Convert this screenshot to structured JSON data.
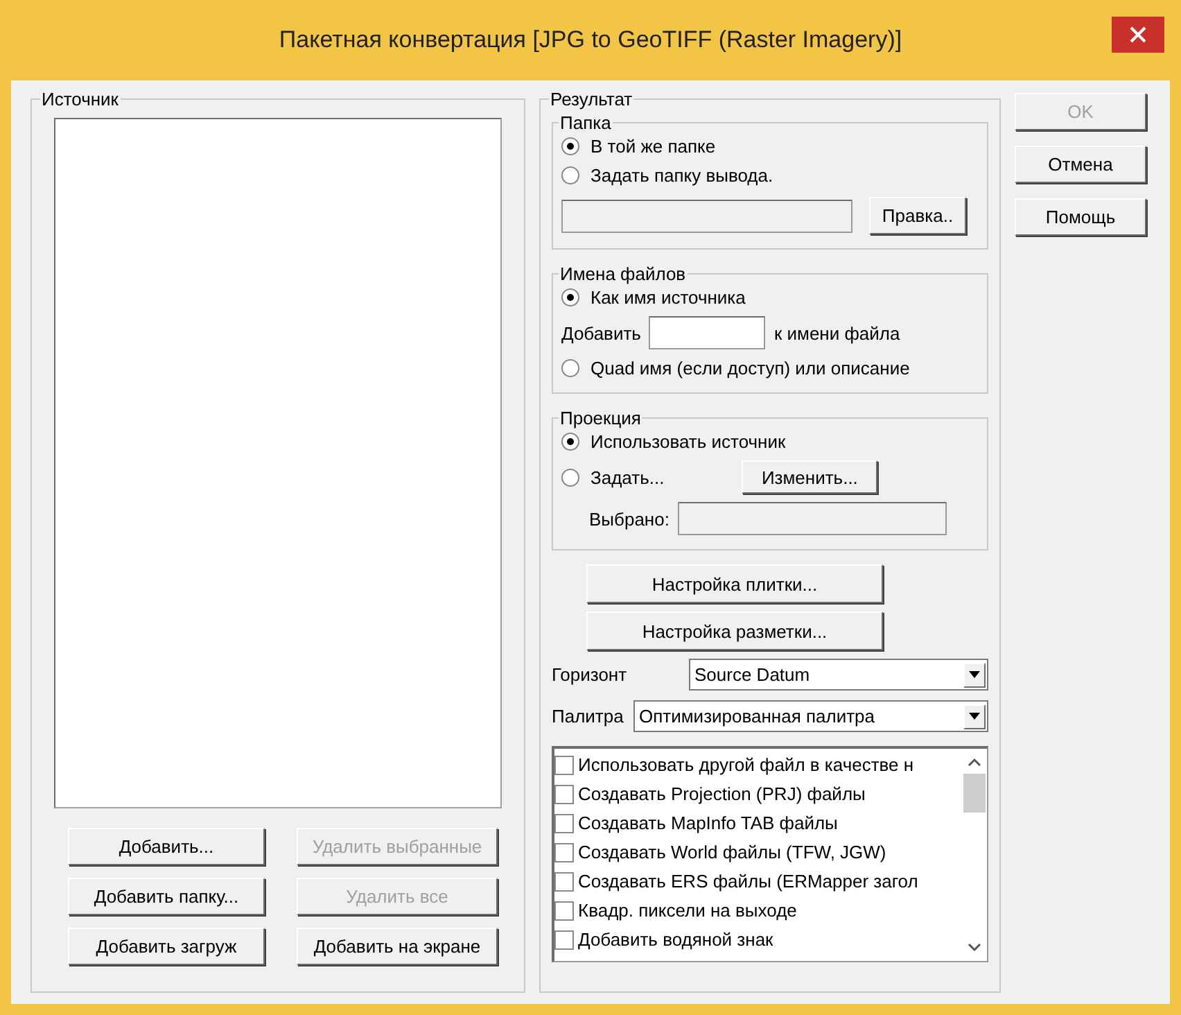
{
  "window": {
    "title": "Пакетная конвертация [JPG to GeoTIFF (Raster Imagery)]"
  },
  "source": {
    "label": "Источник",
    "buttons": [
      {
        "label": "Добавить...",
        "disabled": false
      },
      {
        "label": "Удалить выбранные",
        "disabled": true
      },
      {
        "label": "Добавить папку...",
        "disabled": false
      },
      {
        "label": "Удалить все",
        "disabled": true
      },
      {
        "label": "Добавить загруж",
        "disabled": false
      },
      {
        "label": "Добавить на экране",
        "disabled": false
      }
    ]
  },
  "result": {
    "label": "Результат",
    "folder": {
      "label": "Папка",
      "options": [
        {
          "label": "В той же папке",
          "selected": true
        },
        {
          "label": "Задать папку вывода.",
          "selected": false
        }
      ],
      "edit_button": "Правка.."
    },
    "file_names": {
      "label": "Имена файлов",
      "options": [
        {
          "label": "Как имя источника",
          "selected": true
        },
        {
          "label": "Quad имя (если доступ) или описание",
          "selected": false
        }
      ],
      "append_label": "Добавить",
      "append_suffix": "к имени файла"
    },
    "projection": {
      "label": "Проекция",
      "options": [
        {
          "label": "Использовать источник",
          "selected": true
        },
        {
          "label": "Задать...",
          "selected": false
        }
      ],
      "change_button": "Изменить...",
      "selected_label": "Выбрано:"
    },
    "tile_button": "Настройка плитки...",
    "markup_button": "Настройка разметки...",
    "datum": {
      "label": "Горизонт",
      "value": "Source Datum"
    },
    "palette": {
      "label": "Палитра",
      "value": "Оптимизированная палитра"
    },
    "options": [
      {
        "label": "Использовать другой файл в качестве н",
        "checked": false
      },
      {
        "label": "Создавать Projection (PRJ) файлы",
        "checked": false
      },
      {
        "label": "Создавать MapInfo TAB файлы",
        "checked": false
      },
      {
        "label": "Создавать World файлы (TFW, JGW)",
        "checked": false
      },
      {
        "label": "Создавать ERS файлы (ERMapper загол",
        "checked": false
      },
      {
        "label": "Квадр. пиксели на выходе",
        "checked": false
      },
      {
        "label": "Добавить водяной знак",
        "checked": false
      }
    ]
  },
  "buttons": [
    {
      "label": "OK",
      "disabled": true
    },
    {
      "label": "Отмена",
      "disabled": false
    },
    {
      "label": "Помощь",
      "disabled": false
    }
  ]
}
